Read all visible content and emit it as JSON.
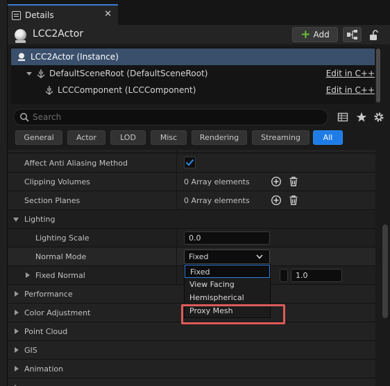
{
  "tab": {
    "title": "Details",
    "close_glyph": "✕"
  },
  "header": {
    "actor_name": "LCC2Actor",
    "add_label": "Add"
  },
  "hierarchy": [
    {
      "label": "LCC2Actor (Instance)",
      "edit": ""
    },
    {
      "label": "DefaultSceneRoot (DefaultSceneRoot)",
      "edit": "Edit in C++"
    },
    {
      "label": "LCCComponent (LCCComponent)",
      "edit": "Edit in C++"
    }
  ],
  "search": {
    "placeholder": "Search"
  },
  "categories": [
    "General",
    "Actor",
    "LOD",
    "Misc",
    "Rendering",
    "Streaming",
    "All"
  ],
  "active_category": "All",
  "properties": {
    "anti_aliasing": {
      "label": "Affect Anti Aliasing Method",
      "checked": true
    },
    "clipping_volumes": {
      "label": "Clipping Volumes",
      "value": "0 Array elements"
    },
    "section_planes": {
      "label": "Section Planes",
      "value": "0 Array elements"
    },
    "lighting": {
      "label": "Lighting"
    },
    "lighting_scale": {
      "label": "Lighting Scale",
      "value": "0.0"
    },
    "normal_mode": {
      "label": "Normal Mode",
      "value": "Fixed"
    },
    "fixed_normal": {
      "label": "Fixed Normal",
      "z_value": "1.0"
    },
    "performance": {
      "label": "Performance"
    },
    "color_adjustment": {
      "label": "Color Adjustment"
    },
    "point_cloud": {
      "label": "Point Cloud"
    },
    "gis": {
      "label": "GIS"
    },
    "animation": {
      "label": "Animation"
    }
  },
  "dropdown": {
    "options": [
      "Fixed",
      "View Facing",
      "Hemispherical",
      "Proxy Mesh"
    ],
    "selected": "Fixed",
    "highlighted": "Proxy Mesh"
  },
  "colors": {
    "accent": "#1f7ce6",
    "selection": "#3a4f6c",
    "highlight_box": "#e05a5a",
    "add_icon": "#6abf3a",
    "checkbox": "#2d7fd8"
  }
}
